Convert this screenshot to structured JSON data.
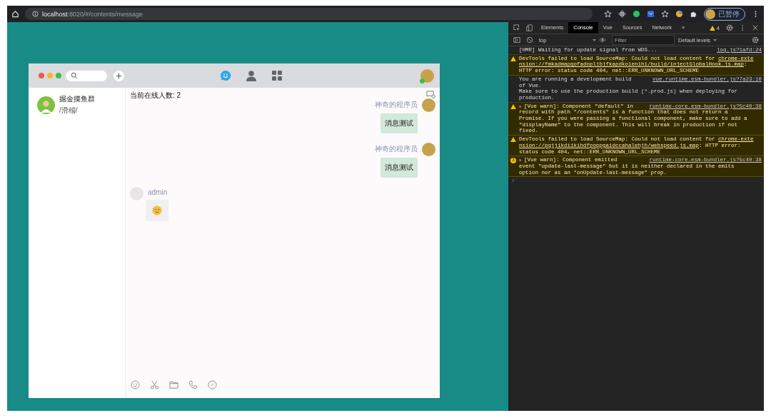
{
  "browser": {
    "url_host": "localhost",
    "url_path": ":8020/#/contents/message",
    "profile_label": "已暂停"
  },
  "devtools": {
    "tabs": [
      {
        "label": "Elements",
        "selected": false
      },
      {
        "label": "Console",
        "selected": true
      },
      {
        "label": "Vue",
        "selected": false
      },
      {
        "label": "Sources",
        "selected": false
      },
      {
        "label": "Network",
        "selected": false
      }
    ],
    "more_tabs": "»",
    "warnings_count": "4",
    "context": "top",
    "filter_placeholder": "Filter",
    "levels": "Default levels",
    "messages": [
      {
        "kind": "info",
        "source": "log.js?1afd:24",
        "expandable": false,
        "lines": [
          {
            "before": "[HMR] Waiting for update signal from WDS..."
          }
        ]
      },
      {
        "kind": "warning",
        "expandable": false,
        "lines": [
          {
            "before": "DevTools failed to load SourceMap: Could not load content for ",
            "link": "chrome-exte"
          },
          {
            "link": "nsion://fmkadmapgofadopljbjfkapdkoienihi/build/injectGlobalHook.js.map",
            "after": ":"
          },
          {
            "before": "HTTP error: status code 404, net::ERR_UNKNOWN_URL_SCHEME"
          }
        ]
      },
      {
        "kind": "info",
        "source": "vue.runtime.esm-bundler.js?7a23:10",
        "expandable": false,
        "lines": [
          {
            "before": "You are running a development build"
          },
          {
            "before": "of Vue."
          },
          {
            "before": "Make sure to use the production build (*.prod.js) when deploying for"
          },
          {
            "before": "production."
          }
        ]
      },
      {
        "kind": "warning",
        "source": "runtime-core.esm-bundler.js?5c40:38",
        "expandable": true,
        "lines": [
          {
            "before": "[Vue warn]: Component \"default\" in"
          },
          {
            "before": "record with path \"/contents\" is a function that does not return a"
          },
          {
            "before": "Promise. If you were passing a functional component, make sure to add a"
          },
          {
            "before": "\"displayName\" to the component. This will break in production if not"
          },
          {
            "before": "fixed."
          }
        ]
      },
      {
        "kind": "warning",
        "expandable": false,
        "lines": [
          {
            "before": "DevTools failed to load SourceMap: Could not load content for ",
            "link": "chrome-exte"
          },
          {
            "link": "nsion://pgjjikdiikihdfpoppgaidccahalehjh/webspeed.js.map",
            "after": ": HTTP error:"
          },
          {
            "before": "status code 404, net::ERR_UNKNOWN_URL_SCHEME"
          }
        ]
      },
      {
        "kind": "repeat",
        "count": "3",
        "source": "runtime-core.esm-bundler.js?5c40:38",
        "expandable": true,
        "lines": [
          {
            "before": "[Vue warn]: Component emitted"
          },
          {
            "before": "event \"update-last-message\" but it is neither declared in the emits"
          },
          {
            "before": "option nor as an \"onUpdate-last-message\" prop."
          }
        ]
      }
    ],
    "prompt": "›"
  },
  "app": {
    "nav": [
      {
        "kind": "chat",
        "selected": true
      },
      {
        "kind": "contacts",
        "selected": false
      },
      {
        "kind": "apps",
        "selected": false
      }
    ],
    "user_online": true,
    "sessions": [
      {
        "name": "掘金摸鱼群",
        "subtitle": "/滑稽/"
      }
    ],
    "online_count": "当前在线人数: 2",
    "messages": [
      {
        "outgoing": true,
        "sender": "神奇的程序员",
        "kind": "text",
        "text": "消息测试"
      },
      {
        "outgoing": true,
        "sender": "神奇的程序员",
        "kind": "text",
        "text": "消息测试"
      },
      {
        "outgoing": false,
        "sender": "admin",
        "kind": "emoji"
      }
    ]
  }
}
